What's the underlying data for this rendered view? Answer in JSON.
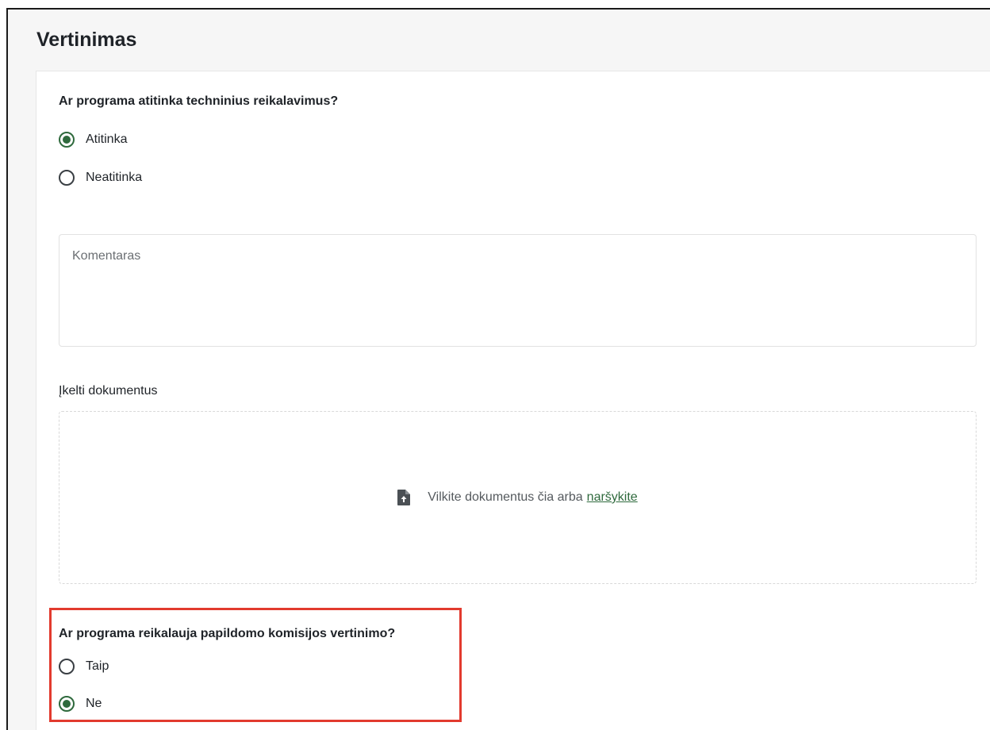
{
  "section": {
    "title": "Vertinimas"
  },
  "q1": {
    "question": "Ar programa atitinka techninius reikalavimus?",
    "options": [
      {
        "label": "Atitinka",
        "checked": true
      },
      {
        "label": "Neatitinka",
        "checked": false
      }
    ]
  },
  "comment": {
    "placeholder": "Komentaras"
  },
  "upload": {
    "label": "Įkelti dokumentus",
    "hint": "Vilkite dokumentus čia arba",
    "browse": "naršykite",
    "icon": "file-upload-icon"
  },
  "q2": {
    "question": "Ar programa reikalauja papildomo komisijos vertinimo?",
    "options": [
      {
        "label": "Taip",
        "checked": false
      },
      {
        "label": "Ne",
        "checked": true
      }
    ]
  },
  "colors": {
    "accent": "#2f6a3d",
    "highlight": "#e23a2e"
  }
}
